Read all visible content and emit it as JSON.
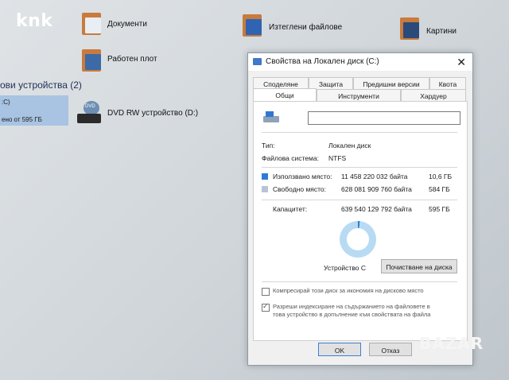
{
  "brand": "knk",
  "explorer": {
    "items": [
      {
        "label": "Документи",
        "icon": "documents-folder-icon"
      },
      {
        "label": "Изтеглени файлове",
        "icon": "downloads-folder-icon"
      },
      {
        "label": "Картини",
        "icon": "pictures-folder-icon"
      },
      {
        "label": "Работен плот",
        "icon": "desktop-folder-icon"
      }
    ],
    "section_title": "ови устройства (2)",
    "drive": {
      "name": ":C)",
      "free": "ено от 595 ГБ"
    },
    "dvd": {
      "label": "DVD RW устройство (D:)",
      "icon_text": "DVD"
    }
  },
  "dialog": {
    "title": "Свойства на Локален диск (C:)",
    "close": "✕",
    "tabs_row1": [
      "Споделяне",
      "Защита",
      "Предишни версии",
      "Квота"
    ],
    "tabs_row2": [
      "Общи",
      "Инструменти",
      "Хардуер"
    ],
    "name_value": "",
    "type_label": "Тип:",
    "type_value": "Локален диск",
    "fs_label": "Файлова система:",
    "fs_value": "NTFS",
    "used": {
      "label": "Използвано място:",
      "bytes": "11 458 220 032 байта",
      "size": "10,6 ГБ",
      "color": "#2e7bd6"
    },
    "free": {
      "label": "Свободно място:",
      "bytes": "628 081 909 760 байта",
      "size": "584 ГБ",
      "color": "#b8c4d6"
    },
    "capacity": {
      "label": "Капацитет:",
      "bytes": "639 540 129 792 байта",
      "size": "595 ГБ"
    },
    "device_label": "Устройство C",
    "cleanup_button": "Почистване на диска",
    "compress_label": "Компресирай този диск за икономия на дисково място",
    "compress_checked": false,
    "index_label_1": "Разреши индексиране на съдържанието на файловете в",
    "index_label_2": "това устройство в допълнение към свойствата на файла",
    "index_checked": true,
    "ok": "OK",
    "cancel": "Отказ"
  },
  "watermark": "BAZAR"
}
